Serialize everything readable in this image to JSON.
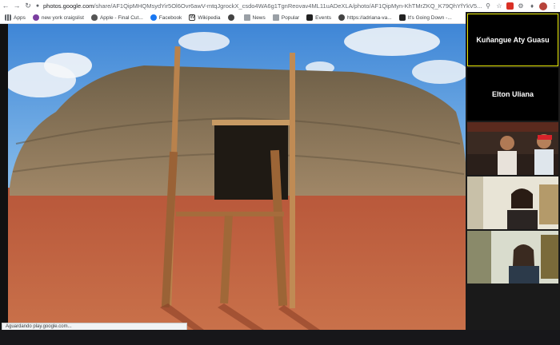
{
  "browser": {
    "url_host": "photos.google.com",
    "url_path": "/share/AF1QipMHQMsydYir5Ol6Ovr6awV-mtqJgrockX_csdo4WA6g1TgnReovav4ML11uADeXLA/photo/AF1QipMyn-KhTMrZKQ_K79QhYfYkV5...",
    "bookmarks": [
      {
        "label": "Apps",
        "icon": "apps-grid-icon"
      },
      {
        "label": "new york craigslist",
        "icon": "peace-icon"
      },
      {
        "label": "Apple - Final Cut...",
        "icon": "apple-icon"
      },
      {
        "label": "Facebook",
        "icon": "facebook-icon"
      },
      {
        "label": "Wikipedia",
        "icon": "wikipedia-icon"
      },
      {
        "label": "",
        "icon": "globe-icon"
      },
      {
        "label": "News",
        "icon": "folder-icon"
      },
      {
        "label": "Popular",
        "icon": "folder-icon"
      },
      {
        "label": "Events",
        "icon": "events-icon"
      },
      {
        "label": "https://adriana-va...",
        "icon": "site-icon"
      },
      {
        "label": "It's Going Down -...",
        "icon": "site-icon"
      }
    ]
  },
  "status_text": "Aguardando play.google.com...",
  "participants": [
    {
      "name": "Kuñangue Aty Guasu",
      "active": true
    },
    {
      "name": "Elton Uliana",
      "active": false
    }
  ],
  "colors": {
    "sky": "#4a8fd8",
    "thatch": "#8f7a5c",
    "ground": "#c0603b",
    "active_border": "#e6e600"
  }
}
